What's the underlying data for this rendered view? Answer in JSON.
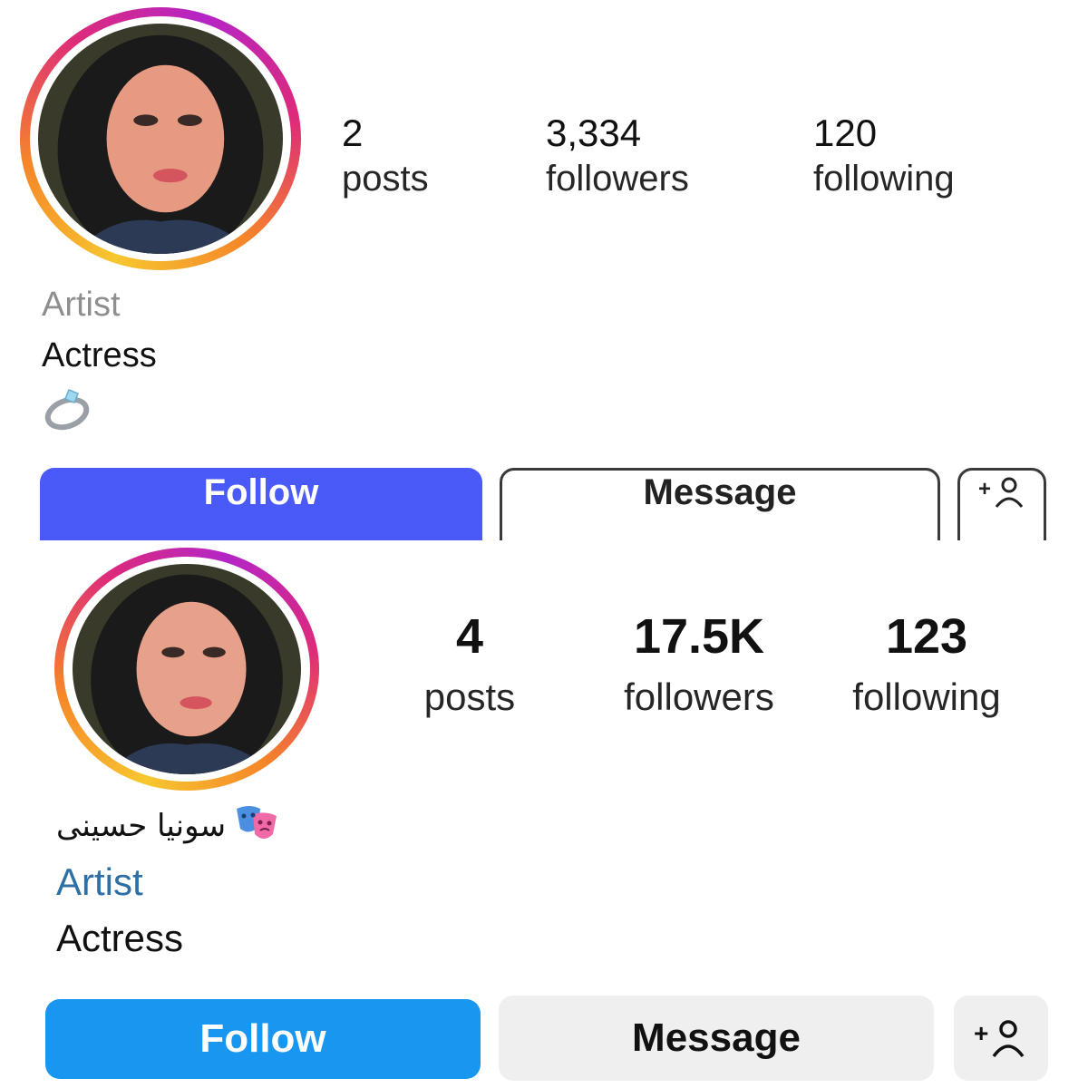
{
  "top": {
    "stats": [
      {
        "value": "2",
        "label": "posts"
      },
      {
        "value": "3,334",
        "label": "followers"
      },
      {
        "value": "120",
        "label": "following"
      }
    ],
    "bio": {
      "category": "Artist",
      "line": "Actress",
      "emoji": "💍"
    },
    "buttons": {
      "follow": "Follow",
      "message": "Message"
    },
    "colors": {
      "follow": "#4a5af8",
      "category": "#8e8e8e"
    }
  },
  "bottom": {
    "name": "سونیا حسینی",
    "name_emoji": "🎭",
    "stats": [
      {
        "value": "4",
        "label": "posts"
      },
      {
        "value": "17.5K",
        "label": "followers"
      },
      {
        "value": "123",
        "label": "following"
      }
    ],
    "bio": {
      "category": "Artist",
      "line": "Actress"
    },
    "buttons": {
      "follow": "Follow",
      "message": "Message"
    },
    "colors": {
      "follow": "#1896f0",
      "category": "#2e6fa6",
      "message_bg": "#efefef"
    }
  },
  "icons": {
    "add_user": "add-user-icon",
    "ring": "ring-emoji",
    "masks": "theater-masks-emoji"
  }
}
